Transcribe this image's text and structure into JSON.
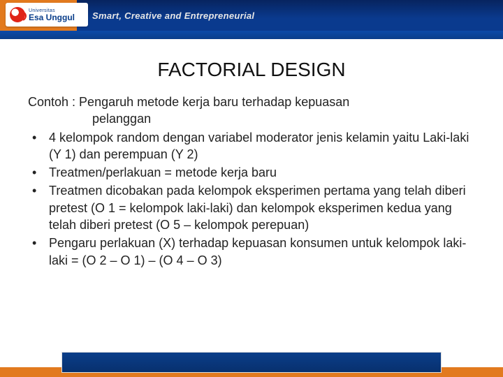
{
  "header": {
    "logo_line1": "Universitas",
    "logo_line2": "Esa Unggul",
    "tagline": "Smart, Creative and Entrepreneurial"
  },
  "title": "FACTORIAL DESIGN",
  "lead_line1": "Contoh : Pengaruh metode kerja baru terhadap kepuasan",
  "lead_line2": "pelanggan",
  "bullets": [
    "4 kelompok random dengan variabel moderator jenis kelamin yaitu Laki-laki (Y 1) dan perempuan (Y 2)",
    "Treatmen/perlakuan = metode kerja baru",
    "Treatmen dicobakan pada kelompok eksperimen pertama yang telah diberi pretest (O 1 = kelompok laki-laki) dan kelompok eksperimen kedua yang telah diberi pretest (O 5 – kelompok perepuan)",
    "Pengaru perlakuan (X) terhadap kepuasan konsumen untuk kelompok laki-laki = (O 2 – O 1) – (O 4 – O 3)"
  ]
}
